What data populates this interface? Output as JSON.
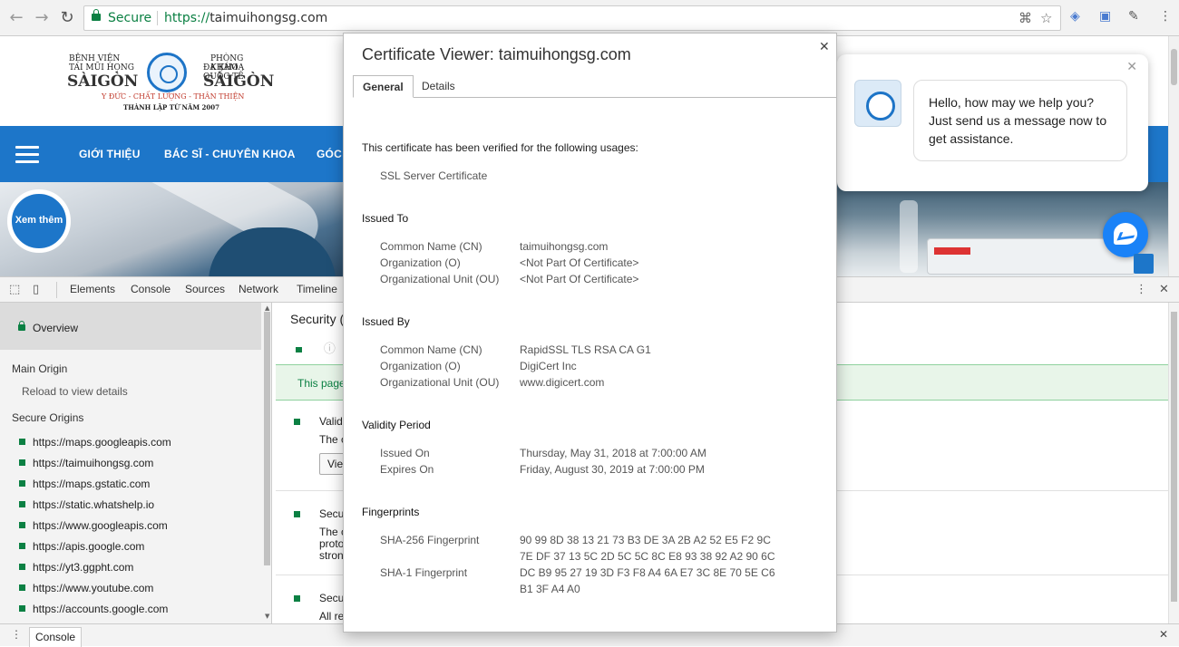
{
  "browser": {
    "secure_label": "Secure",
    "url_scheme": "https://",
    "url_host": "taimuihongsg.com"
  },
  "site": {
    "logo": {
      "left_line1": "BỆNH VIỆN",
      "left_line2": "TAI MŨI HỌNG",
      "left_line3": "SÀIGÒN",
      "right_line1": "PHÒNG KHÁM",
      "right_line2": "ĐA KHOA QUỐC TẾ",
      "right_line3": "SÀIGÒN",
      "tagline": "Y ĐỨC - CHẤT LƯỢNG - THÂN THIỆN",
      "founded": "THÀNH LẬP TỪ NĂM 2007"
    },
    "nav": [
      "GIỚI THIỆU",
      "BÁC SĨ - CHUYÊN KHOA",
      "GÓC"
    ],
    "xem_them": "Xem thêm",
    "chat_message": "Hello, how may we help you? Just send us a message now to get assistance."
  },
  "devtools": {
    "tabs": [
      "Elements",
      "Console",
      "Sources",
      "Network",
      "Timeline"
    ],
    "sidebar": {
      "overview": "Overview",
      "main_origin": "Main Origin",
      "reload": "Reload to view details",
      "secure_origins": "Secure Origins",
      "origins": [
        "https://maps.googleapis.com",
        "https://taimuihongsg.com",
        "https://maps.gstatic.com",
        "https://static.whatshelp.io",
        "https://www.googleapis.com",
        "https://apis.google.com",
        "https://yt3.ggpht.com",
        "https://www.youtube.com",
        "https://accounts.google.com"
      ]
    },
    "main": {
      "title": "Security (",
      "banner": "This page",
      "section1_title": "Validi",
      "section1_text": "The c",
      "view_btn": "Vie",
      "section2_title": "Secu",
      "section2_lines": [
        "The c",
        "proto",
        "stron"
      ],
      "section3_title": "Secu",
      "section3_text": "All re"
    },
    "console_tab": "Console"
  },
  "cert": {
    "title": "Certificate Viewer: taimuihongsg.com",
    "tab_general": "General",
    "tab_details": "Details",
    "verified_text": "This certificate has been verified for the following usages:",
    "usage": "SSL Server Certificate",
    "issued_to": {
      "heading": "Issued To",
      "cn_label": "Common Name (CN)",
      "cn": "taimuihongsg.com",
      "o_label": "Organization (O)",
      "o": "<Not Part Of Certificate>",
      "ou_label": "Organizational Unit (OU)",
      "ou": "<Not Part Of Certificate>"
    },
    "issued_by": {
      "heading": "Issued By",
      "cn_label": "Common Name (CN)",
      "cn": "RapidSSL TLS RSA CA G1",
      "o_label": "Organization (O)",
      "o": "DigiCert Inc",
      "ou_label": "Organizational Unit (OU)",
      "ou": "www.digicert.com"
    },
    "validity": {
      "heading": "Validity Period",
      "issued_label": "Issued On",
      "issued": "Thursday, May 31, 2018 at 7:00:00 AM",
      "expires_label": "Expires On",
      "expires": "Friday, August 30, 2019 at 7:00:00 PM"
    },
    "fingerprints": {
      "heading": "Fingerprints",
      "sha256_label": "SHA-256 Fingerprint",
      "sha256_line1": "90 99 8D 38 13 21 73 B3 DE 3A 2B A2 52 E5 F2 9C",
      "sha256_line2": "7E DF 37 13 5C 2D 5C 5C 8C E8 93 38 92 A2 90 6C",
      "sha1_label": "SHA-1 Fingerprint",
      "sha1_line1": "DC B9 95 27 19 3D F3 F8 A4 6A E7 3C 8E 70 5E C6",
      "sha1_line2": "B1 3F A4 A0"
    }
  }
}
